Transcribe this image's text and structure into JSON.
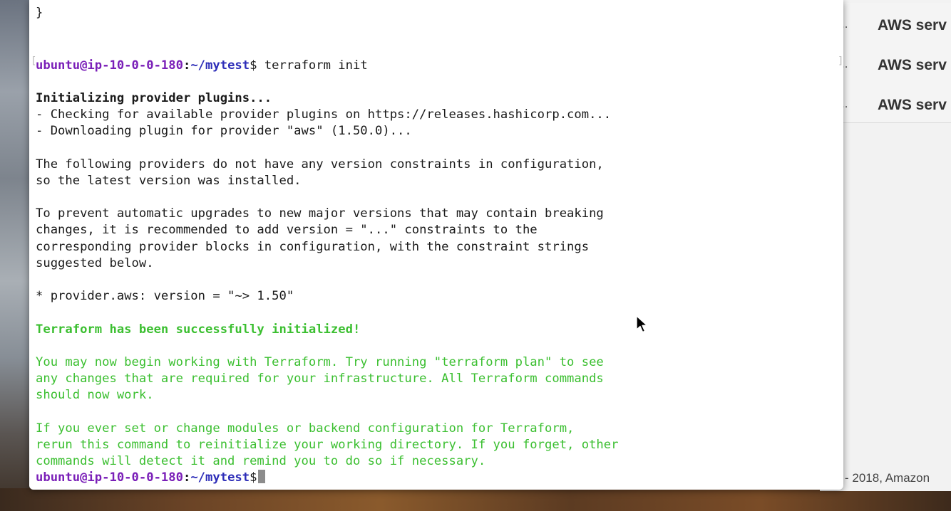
{
  "browser": {
    "rows": [
      {
        "prefix": "..",
        "title": "AWS serv"
      },
      {
        "prefix": "..",
        "title": "AWS serv"
      },
      {
        "prefix": "..",
        "title": "AWS serv"
      }
    ],
    "footer": "- 2018, Amazon"
  },
  "terminal": {
    "top_partial": "}",
    "prompt_user": "ubuntu@ip-10-0-0-180",
    "prompt_sep": ":",
    "prompt_path": "~/mytest",
    "prompt_symbol": "$",
    "command": " terraform init",
    "init_heading": "Initializing provider plugins...",
    "check_line": "- Checking for available provider plugins on https://releases.hashicorp.com...",
    "download_line": "- Downloading plugin for provider \"aws\" (1.50.0)...",
    "no_constraint_1": "The following providers do not have any version constraints in configuration,",
    "no_constraint_2": "so the latest version was installed.",
    "prevent_1": "To prevent automatic upgrades to new major versions that may contain breaking",
    "prevent_2": "changes, it is recommended to add version = \"...\" constraints to the",
    "prevent_3": "corresponding provider blocks in configuration, with the constraint strings",
    "prevent_4": "suggested below.",
    "provider_version": "* provider.aws: version = \"~> 1.50\"",
    "success": "Terraform has been successfully initialized!",
    "begin_1": "You may now begin working with Terraform. Try running \"terraform plan\" to see",
    "begin_2": "any changes that are required for your infrastructure. All Terraform commands",
    "begin_3": "should now work.",
    "rerun_1": "If you ever set or change modules or backend configuration for Terraform,",
    "rerun_2": "rerun this command to reinitialize your working directory. If you forget, other",
    "rerun_3": "commands will detect it and remind you to do so if necessary."
  },
  "colors": {
    "success_green": "#3bbf30",
    "prompt_user": "#7a1fb8",
    "prompt_path": "#2d2db8"
  }
}
